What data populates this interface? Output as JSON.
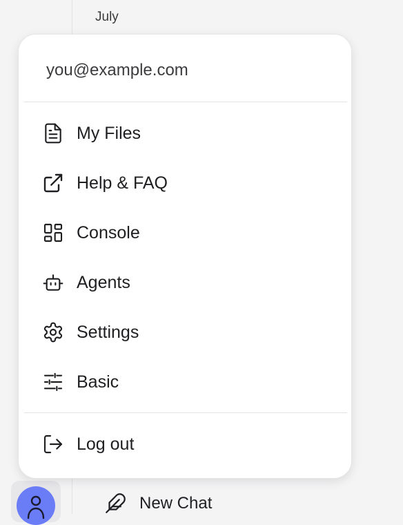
{
  "sidebar": {
    "month_label": "July",
    "new_chat_label": "New Chat",
    "avatar_icon": "user-icon",
    "new_chat_icon": "feather-icon"
  },
  "account_menu": {
    "email": "you@example.com",
    "items": [
      {
        "label": "My Files",
        "icon": "file-icon"
      },
      {
        "label": "Help & FAQ",
        "icon": "external-link-icon"
      },
      {
        "label": "Console",
        "icon": "dashboard-icon"
      },
      {
        "label": "Agents",
        "icon": "robot-icon"
      },
      {
        "label": "Settings",
        "icon": "gear-icon"
      },
      {
        "label": "Basic",
        "icon": "sliders-icon"
      }
    ],
    "logout": {
      "label": "Log out",
      "icon": "logout-icon"
    }
  },
  "colors": {
    "background": "#f4f4f5",
    "menu_background": "#ffffff",
    "avatar": "#6b7cf7",
    "text": "#1f1f22"
  }
}
